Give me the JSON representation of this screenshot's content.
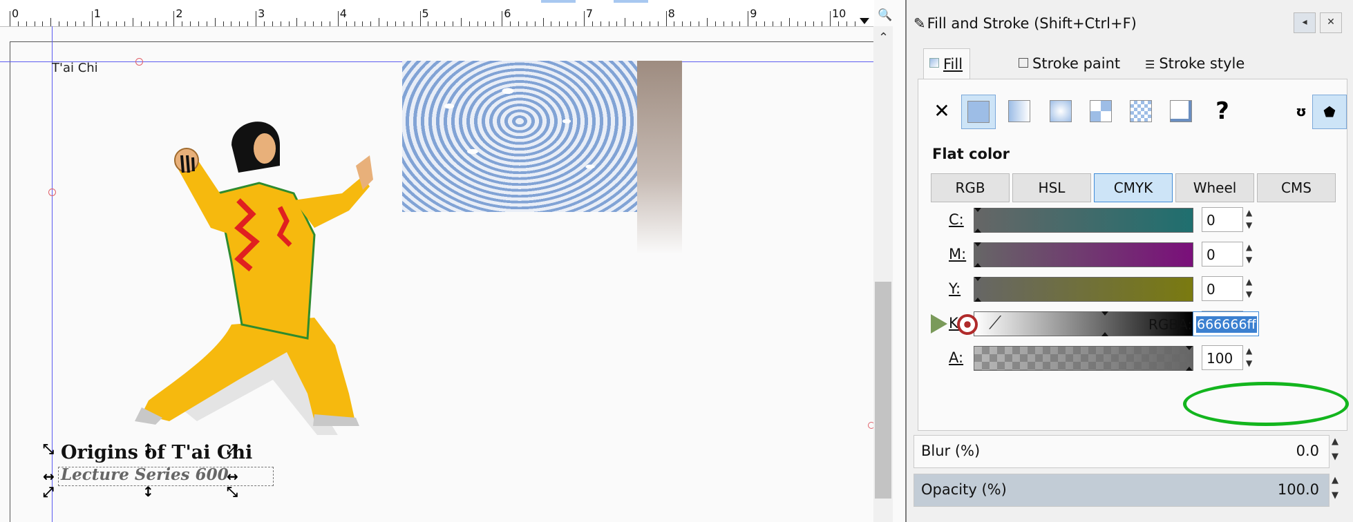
{
  "canvas": {
    "ruler_numbers": [
      "0",
      "1",
      "2",
      "3",
      "4",
      "5",
      "6",
      "7",
      "8",
      "9",
      "10"
    ],
    "document_label": "T'ai Chi",
    "title_line1": "Origins of T'ai Chi",
    "title_line2": "Lecture Series 600"
  },
  "panel": {
    "title": "Fill and Stroke (Shift+Ctrl+F)",
    "header_buttons": {
      "collapse": "◂",
      "close": "✕"
    },
    "tabs": {
      "fill": "Fill",
      "stroke_paint": "Stroke paint",
      "stroke_style": "Stroke style"
    },
    "paint_types": [
      "no-paint",
      "flat-color",
      "linear-gradient",
      "radial-gradient",
      "mesh-gradient",
      "pattern",
      "swatch",
      "unset"
    ],
    "paint_unset_label": "?",
    "fill_rule_icons": [
      "evenodd-icon",
      "nonzero-icon"
    ],
    "flat_color_label": "Flat color",
    "color_modes": [
      "RGB",
      "HSL",
      "CMYK",
      "Wheel",
      "CMS"
    ],
    "selected_mode": "CMYK",
    "channels": [
      {
        "label": "C:",
        "value": "0",
        "gradient_end": "#1f6f6f",
        "marker": 0
      },
      {
        "label": "M:",
        "value": "0",
        "gradient_end": "#7a0f7a",
        "marker": 0
      },
      {
        "label": "Y:",
        "value": "0",
        "gradient_end": "#7a7a10",
        "marker": 0
      },
      {
        "label": "K:",
        "value": "60",
        "gradient_end": "#000000",
        "marker": 0.6
      },
      {
        "label": "A:",
        "value": "100",
        "gradient_end": "#666666",
        "marker": 1
      }
    ],
    "rgba_label": "RGBA:",
    "rgba_value": "666666ff",
    "blur_label": "Blur (%)",
    "blur_value": "0.0",
    "opacity_label": "Opacity (%)",
    "opacity_value": "100.0",
    "highlight_color": "#13b51e",
    "accent_color": "#3f8bd8"
  }
}
